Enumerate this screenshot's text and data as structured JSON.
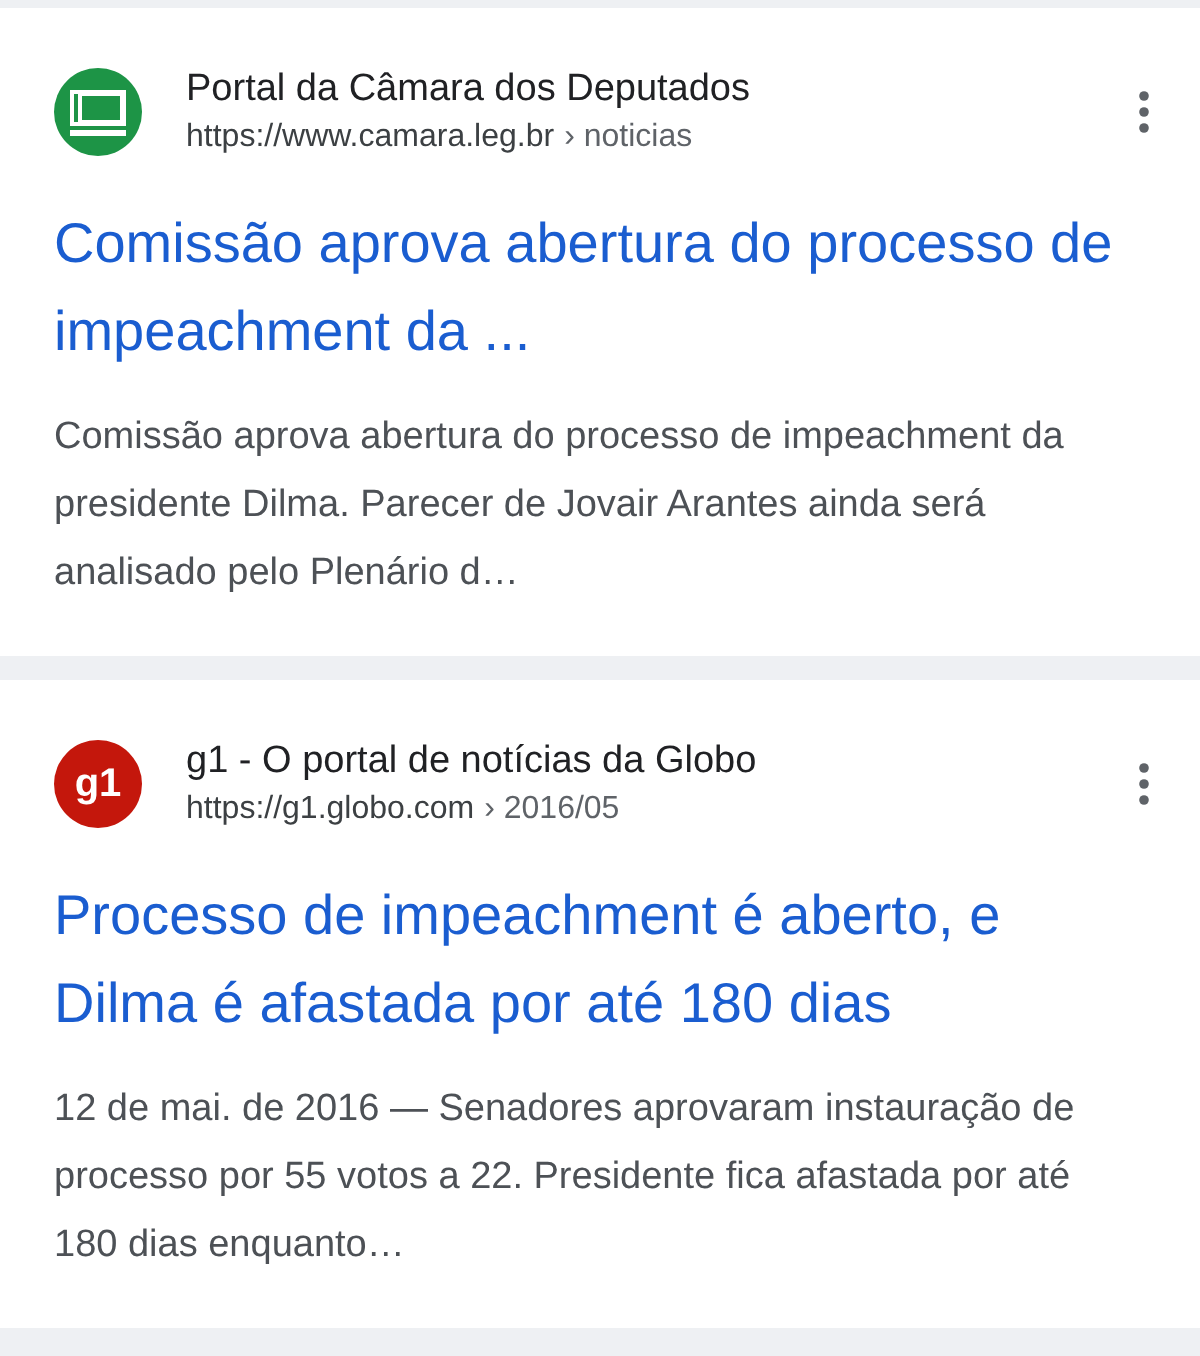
{
  "results": [
    {
      "favicon": {
        "kind": "camara"
      },
      "site_name": "Portal da Câmara dos Deputados",
      "url": "https://www.camara.leg.br",
      "path": "› noticias",
      "title": "Comissão aprova abertura do processo de impeachment da ...",
      "snippet": "Comissão aprova abertura do processo de impeachment da presidente Dilma. Parecer de Jovair Arantes ainda será analisado pelo Plenário d…"
    },
    {
      "favicon": {
        "kind": "g1",
        "text": "g1"
      },
      "site_name": "g1 - O portal de notícias da Globo",
      "url": "https://g1.globo.com",
      "path": "› 2016/05",
      "title": "Processo de impeachment é aberto, e Dilma é afastada por até 180 dias",
      "snippet": "12 de mai. de 2016 — Senadores aprovaram instauração de processo por 55 votos a 22. Presidente fica afastada por até 180 dias enquanto…"
    }
  ]
}
